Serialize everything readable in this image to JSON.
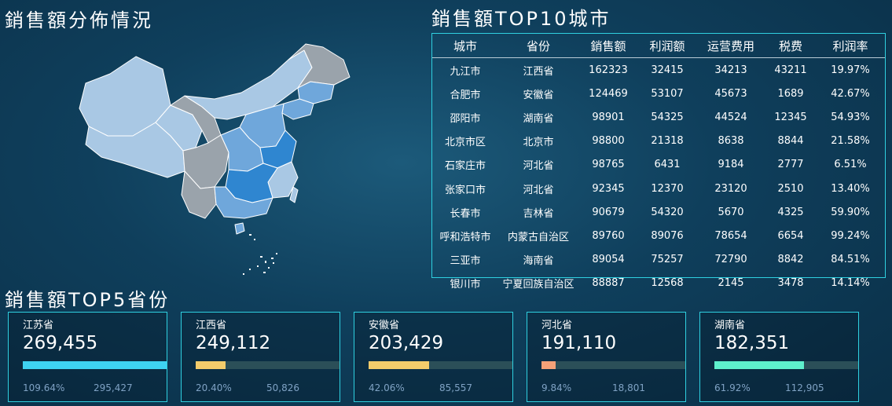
{
  "map_section": {
    "title": "銷售額分佈情況"
  },
  "top10": {
    "title": "銷售額TOP10城市",
    "columns": [
      "城市",
      "省份",
      "銷售额",
      "利润额",
      "运营费用",
      "税费",
      "利润率"
    ],
    "rows": [
      [
        "九江市",
        "江西省",
        "162323",
        "32415",
        "34213",
        "43211",
        "19.97%"
      ],
      [
        "合肥市",
        "安徽省",
        "124469",
        "53107",
        "45673",
        "1689",
        "42.67%"
      ],
      [
        "邵阳市",
        "湖南省",
        "98901",
        "54325",
        "44524",
        "12345",
        "54.93%"
      ],
      [
        "北京市区",
        "北京市",
        "98800",
        "21318",
        "8638",
        "8844",
        "21.58%"
      ],
      [
        "石家庄市",
        "河北省",
        "98765",
        "6431",
        "9184",
        "2777",
        "6.51%"
      ],
      [
        "张家口市",
        "河北省",
        "92345",
        "12370",
        "23120",
        "2510",
        "13.40%"
      ],
      [
        "长春市",
        "吉林省",
        "90679",
        "54320",
        "5670",
        "4325",
        "59.90%"
      ],
      [
        "呼和浩特市",
        "内蒙古自治区",
        "89760",
        "89076",
        "78654",
        "6654",
        "99.24%"
      ],
      [
        "三亚市",
        "海南省",
        "89054",
        "75257",
        "72790",
        "8842",
        "84.51%"
      ],
      [
        "银川市",
        "宁夏回族自治区",
        "88887",
        "12568",
        "2145",
        "3478",
        "14.14%"
      ]
    ]
  },
  "top5": {
    "title": "銷售額TOP5省份",
    "cards": [
      {
        "province": "江苏省",
        "amount": "269,455",
        "percent": "109.64%",
        "target": "295,427",
        "progress": 1.0,
        "color": "#3ed3f2"
      },
      {
        "province": "江西省",
        "amount": "249,112",
        "percent": "20.40%",
        "target": "50,826",
        "progress": 0.204,
        "color": "#f3cc6b"
      },
      {
        "province": "安徽省",
        "amount": "203,429",
        "percent": "42.06%",
        "target": "85,557",
        "progress": 0.4206,
        "color": "#f3cc6b"
      },
      {
        "province": "河北省",
        "amount": "191,110",
        "percent": "9.84%",
        "target": "18,801",
        "progress": 0.0984,
        "color": "#f4a178"
      },
      {
        "province": "湖南省",
        "amount": "182,351",
        "percent": "61.92%",
        "target": "112,905",
        "progress": 0.6192,
        "color": "#5ef0cc"
      }
    ]
  },
  "colors": {
    "map_grey": "#9aa3ab",
    "map_light": "#a9c8e4",
    "map_mid": "#6fa7db",
    "map_dark": "#2f86d0",
    "border": "#2fd0e0"
  }
}
